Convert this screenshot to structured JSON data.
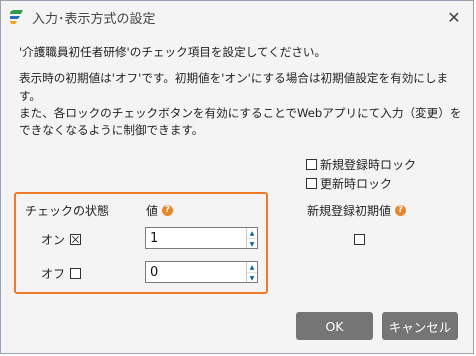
{
  "window": {
    "title": "入力･表示方式の設定"
  },
  "description": {
    "line1": "'介護職員初任者研修'のチェック項目を設定してください。",
    "line2": "表示時の初期値は'オフ'です。初期値を'オン'にする場合は初期値設定を有効にします。",
    "line3": "また、各ロックのチェックボタンを有効にすることでWebアプリにて入力（変更）をできなくなるように制御できます。"
  },
  "locks": {
    "new_registration_lock": {
      "label": "新規登録時ロック",
      "checked": false
    },
    "update_lock": {
      "label": "更新時ロック",
      "checked": false
    }
  },
  "table": {
    "header_state": "チェックの状態",
    "header_value": "値",
    "rows": [
      {
        "label": "オン",
        "checked": true,
        "value": "1"
      },
      {
        "label": "オフ",
        "checked": false,
        "value": "0"
      }
    ]
  },
  "initial_value": {
    "label": "新規登録初期値",
    "checked": false
  },
  "buttons": {
    "ok": "OK",
    "cancel": "キャンセル"
  },
  "colors": {
    "highlight": "#f07a2a",
    "help_icon": "#e8862a",
    "button_bg": "#757575"
  }
}
